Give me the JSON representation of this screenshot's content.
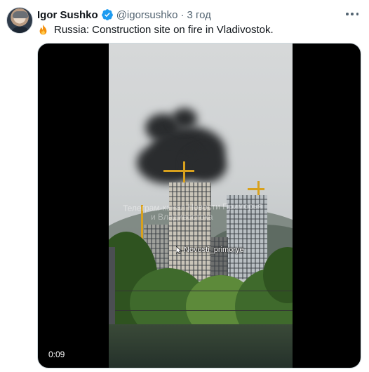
{
  "tweet": {
    "author": {
      "display_name": "Igor Sushko",
      "handle": "@igorsushko",
      "verified_icon": "verified-badge-icon"
    },
    "separator": "·",
    "time": "3 год",
    "text": "Russia: Construction site on fire in Vladivostok.",
    "text_icon": "fire-icon",
    "more_icon": "more-options-icon"
  },
  "video": {
    "watermark_line1": "Телеграм-канал Новости Приморья",
    "watermark_line2": "и Владивостока",
    "overlay_label": "Novosti_primorye",
    "duration": "0:09"
  },
  "colors": {
    "verified": "#1d9bf0",
    "secondary_text": "#536471",
    "primary_text": "#0f1419"
  }
}
